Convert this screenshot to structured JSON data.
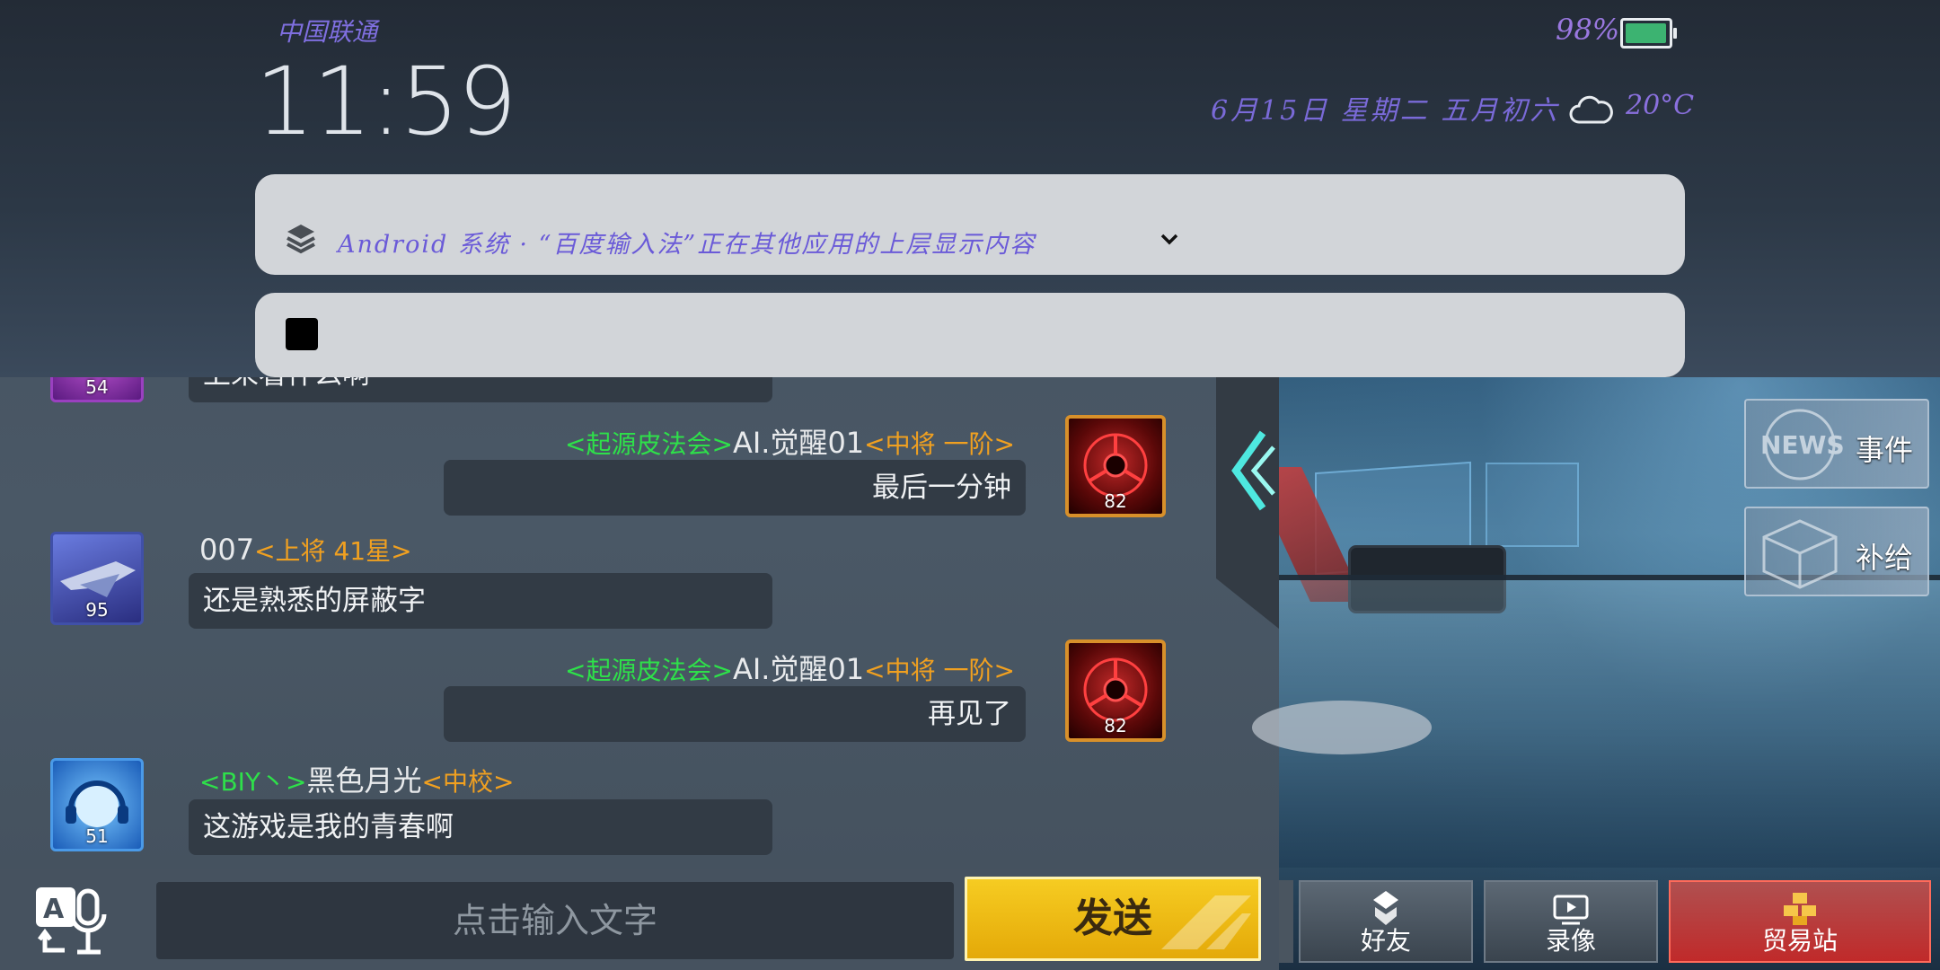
{
  "status_bar": {
    "carrier": "中国联通",
    "time": "11:59",
    "battery_percent": "98%",
    "battery_level": 0.98,
    "date_line": "6月15日 星期二 五月初六",
    "temperature": "20°C",
    "weather_icon": "cloud-icon"
  },
  "notifications": [
    {
      "text": "Android 系统 · “百度输入法”正在其他应用的上层显示内容",
      "icon": "layers-icon"
    },
    {
      "text": "",
      "icon": "stop-icon"
    }
  ],
  "chat": {
    "messages": [
      {
        "side": "left",
        "level": "54",
        "text": "上来看什么啊"
      },
      {
        "side": "right",
        "guild": "<起源皮法会>",
        "name": "AI.觉醒01",
        "rank": "<中将 一阶>",
        "level": "82",
        "text": "最后一分钟"
      },
      {
        "side": "left",
        "guild": "",
        "name": "007",
        "rank": "<上将 41星>",
        "level": "95",
        "text": "还是熟悉的屏蔽字"
      },
      {
        "side": "right",
        "guild": "<起源皮法会>",
        "name": "AI.觉醒01",
        "rank": "<中将 一阶>",
        "level": "82",
        "text": "再见了"
      },
      {
        "side": "left",
        "guild": "<BIY丶>",
        "name": "黑色月光",
        "rank": "<中校>",
        "level": "51",
        "text": "这游戏是我的青春啊"
      }
    ]
  },
  "side_buttons": [
    {
      "label": "事件",
      "icon": "news-icon"
    },
    {
      "label": "补给",
      "icon": "supply-box-icon"
    }
  ],
  "input_bar": {
    "placeholder": "点击输入文字",
    "send_label": "发送"
  },
  "bottom_nav": [
    {
      "label": "好友",
      "icon": "friends-icon"
    },
    {
      "label": "录像",
      "icon": "replay-icon"
    },
    {
      "label": "贸易站",
      "icon": "trade-station-icon"
    }
  ],
  "colors": {
    "guild_tag": "#2ee04a",
    "rank_tag": "#f0a020",
    "send_button": "#f2c01a",
    "trade_button": "#c02a2a",
    "battery_fill": "#3cb371"
  }
}
